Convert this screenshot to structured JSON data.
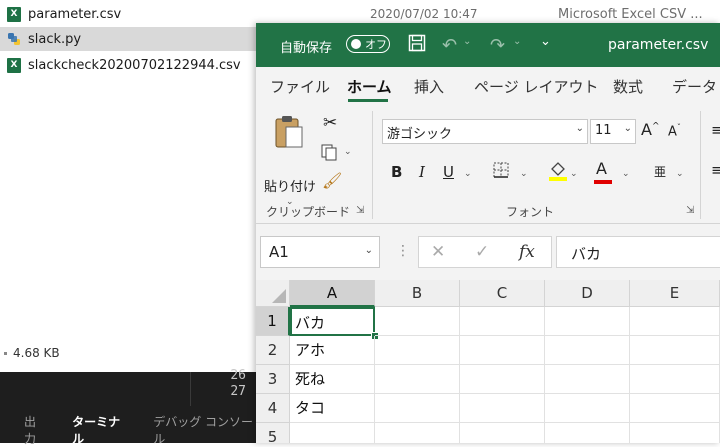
{
  "explorer": {
    "files": [
      {
        "name": "parameter.csv",
        "icon": "excel-csv-icon",
        "date": "2020/07/02 10:47",
        "type": "Microsoft Excel CSV ..."
      },
      {
        "name": "slack.py",
        "icon": "python-file-icon"
      },
      {
        "name": "slackcheck20200702122944.csv",
        "icon": "excel-csv-icon"
      }
    ],
    "status_size": "4.68 KB"
  },
  "terminal": {
    "line_numbers": [
      "26",
      "27"
    ],
    "tabs": [
      "出力",
      "ターミナル",
      "デバッグ コンソール"
    ],
    "active_tab": "ターミナル"
  },
  "excel": {
    "titlebar": {
      "autosave_label": "自動保存",
      "toggle_label": "オフ",
      "file_name": "parameter.csv",
      "accent_color": "#217346"
    },
    "tabs": [
      "ファイル",
      "ホーム",
      "挿入",
      "ページ レイアウト",
      "数式",
      "データ"
    ],
    "active_tab": "ホーム",
    "ribbon": {
      "paste_label": "貼り付け",
      "clipboard_group": "クリップボード",
      "font_group": "フォント",
      "font_name": "游ゴシック",
      "font_size": "11",
      "phonetic_label": "亜"
    },
    "name_box": "A1",
    "formula_value": "バカ",
    "columns": [
      "A",
      "B",
      "C",
      "D",
      "E"
    ],
    "rows": [
      {
        "num": "1",
        "a": "バカ"
      },
      {
        "num": "2",
        "a": "アホ"
      },
      {
        "num": "3",
        "a": "死ね"
      },
      {
        "num": "4",
        "a": "タコ"
      },
      {
        "num": "5",
        "a": ""
      }
    ]
  }
}
